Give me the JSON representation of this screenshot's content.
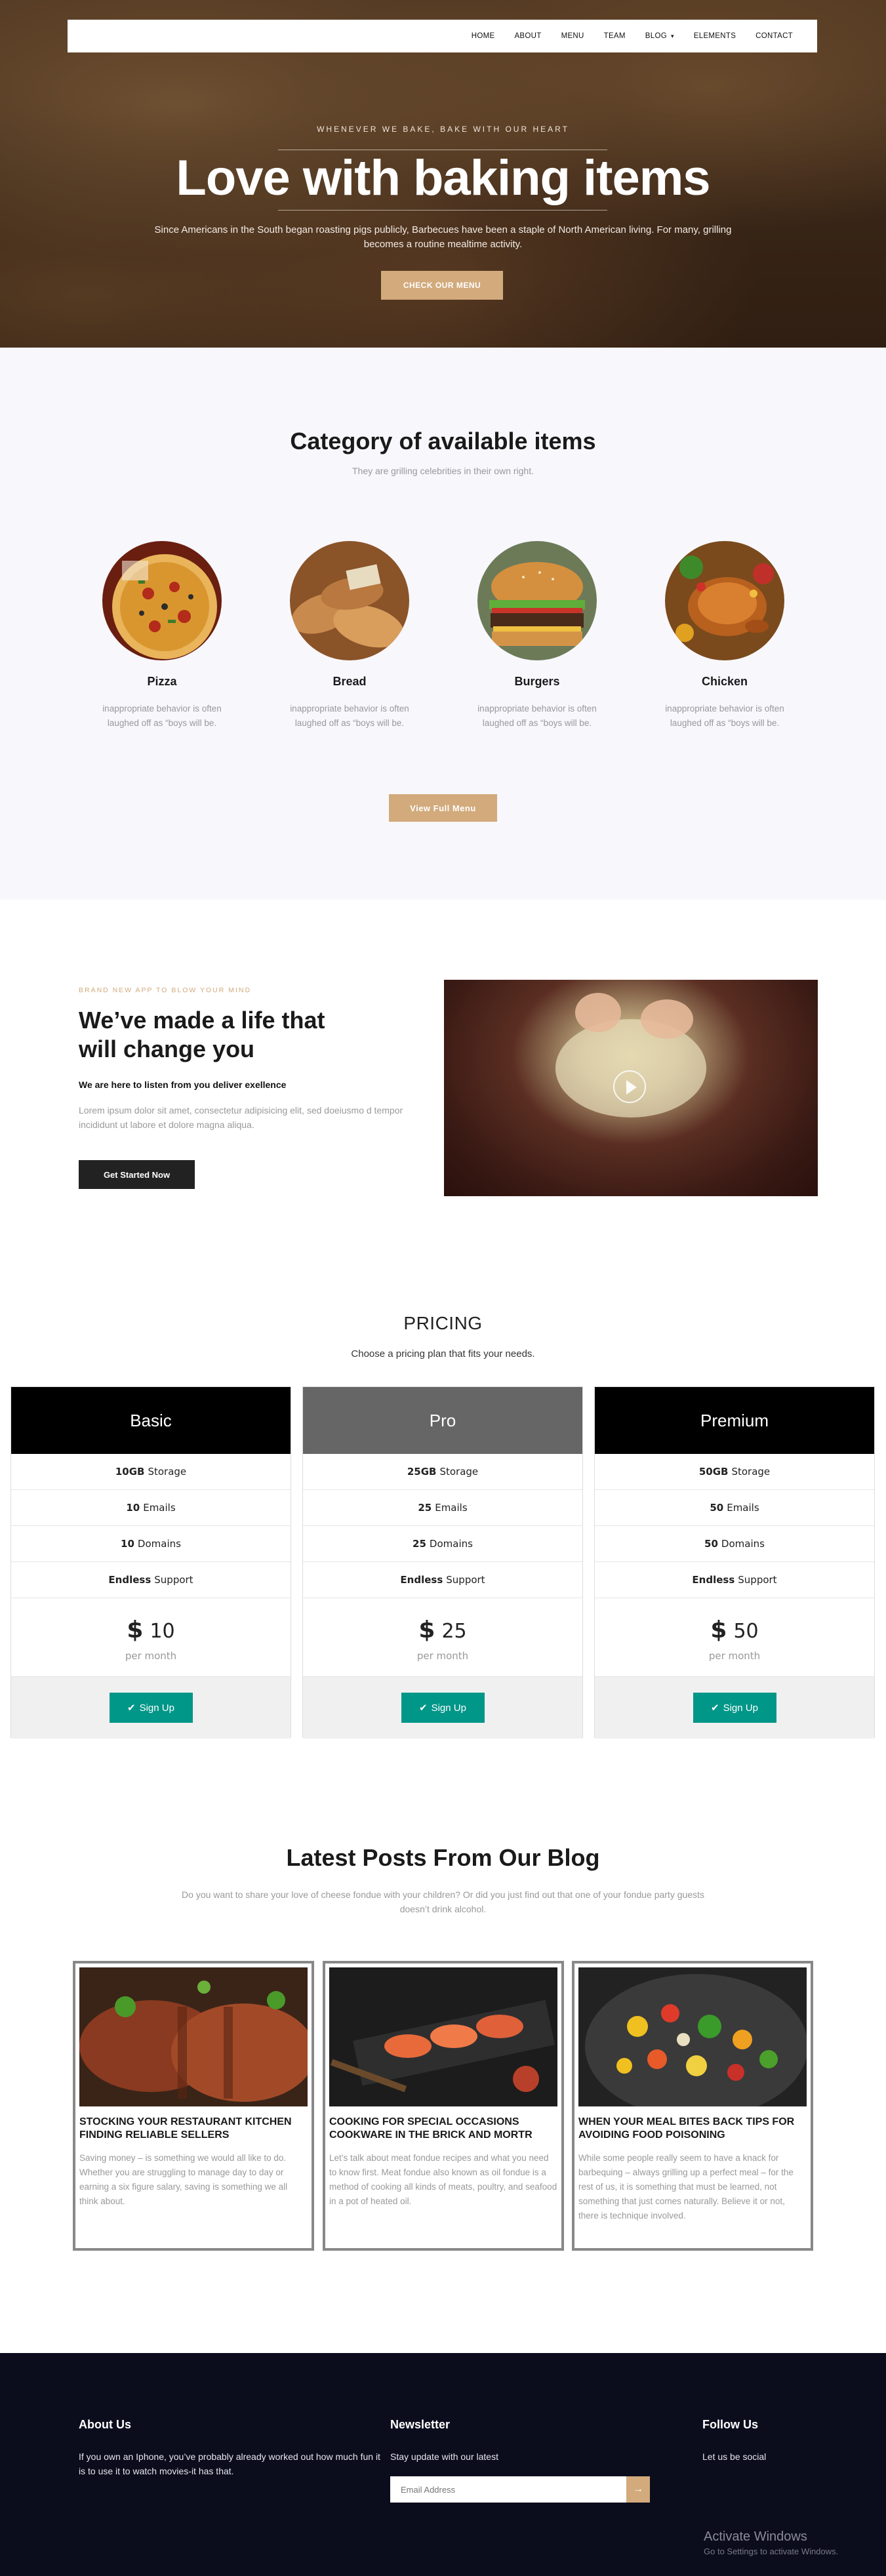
{
  "nav": {
    "items": [
      "HOME",
      "ABOUT",
      "MENU",
      "TEAM",
      "BLOG",
      "ELEMENTS",
      "CONTACT"
    ]
  },
  "hero": {
    "tagline": "WHENEVER WE BAKE, BAKE WITH OUR HEART",
    "title": "Love with baking items",
    "description": "Since Americans in the South began roasting pigs publicly, Barbecues have been a staple of North American living. For many, grilling becomes a routine mealtime activity.",
    "cta": "CHECK OUR MENU"
  },
  "category": {
    "title": "Category of available items",
    "subtitle": "They are grilling celebrities in their own right.",
    "items": [
      {
        "name": "Pizza",
        "text": "inappropriate behavior is often laughed off as “boys will be."
      },
      {
        "name": "Bread",
        "text": "inappropriate behavior is often laughed off as “boys will be."
      },
      {
        "name": "Burgers",
        "text": "inappropriate behavior is often laughed off as “boys will be."
      },
      {
        "name": "Chicken",
        "text": "inappropriate behavior is often laughed off as “boys will be."
      }
    ],
    "button": "View Full Menu"
  },
  "feature": {
    "tag": "BRAND NEW APP TO BLOW YOUR MIND",
    "title": "We’ve made a life that will change you",
    "lead": "We are here to listen from you deliver exellence",
    "body": "Lorem ipsum dolor sit amet, consectetur adipisicing elit, sed doeiusmo d tempor incididunt ut labore et dolore magna aliqua.",
    "button": "Get Started Now"
  },
  "pricing": {
    "title": "PRICING",
    "subtitle": "Choose a pricing plan that fits your needs.",
    "plans": [
      {
        "name": "Basic",
        "color": "#000000",
        "storage": "10GB",
        "emails": "10",
        "domains": "10",
        "support": "Endless",
        "currency": "$",
        "price": "10",
        "period": "per month",
        "button": "Sign Up"
      },
      {
        "name": "Pro",
        "color": "#666666",
        "storage": "25GB",
        "emails": "25",
        "domains": "25",
        "support": "Endless",
        "currency": "$",
        "price": "25",
        "period": "per month",
        "button": "Sign Up"
      },
      {
        "name": "Premium",
        "color": "#000000",
        "storage": "50GB",
        "emails": "50",
        "domains": "50",
        "support": "Endless",
        "currency": "$",
        "price": "50",
        "period": "per month",
        "button": "Sign Up"
      }
    ],
    "labels": {
      "storage": "Storage",
      "emails": "Emails",
      "domains": "Domains",
      "support": "Support"
    }
  },
  "blog": {
    "title": "Latest Posts From Our Blog",
    "subtitle": "Do you want to share your love of cheese fondue with your children? Or did you just find out that one of your fondue party guests doesn’t drink alcohol.",
    "posts": [
      {
        "title": "STOCKING YOUR RESTAURANT KITCHEN FINDING RELIABLE SELLERS",
        "text": "Saving money – is something we would all like to do. Whether you are struggling to manage day to day or earning a six figure salary, saving is something we all think about."
      },
      {
        "title": "COOKING FOR SPECIAL OCCASIONS COOKWARE IN THE BRICK AND MORTR",
        "text": "Let’s talk about meat fondue recipes and what you need to know first. Meat fondue also known as oil fondue is a method of cooking all kinds of meats, poultry, and seafood in a pot of heated oil."
      },
      {
        "title": "WHEN YOUR MEAL BITES BACK TIPS FOR AVOIDING FOOD POISONING",
        "text": "While some people really seem to have a knack for barbequing – always grilling up a perfect meal – for the rest of us, it is something that must be learned, not something that just comes naturally. Believe it or not, there is technique involved."
      }
    ]
  },
  "footer": {
    "about_title": "About Us",
    "about_text": "If you own an Iphone, you’ve probably already worked out how much fun it is to use it to watch movies-it has that.",
    "newsletter_title": "Newsletter",
    "newsletter_text": "Stay update with our latest",
    "email_placeholder": "Email Address",
    "submit_icon": "→",
    "follow_title": "Follow Us",
    "follow_text": "Let us be social",
    "activate_title": "Activate Windows",
    "activate_text": "Go to Settings to activate Windows."
  },
  "icons": {
    "caret": "▾",
    "check": "✔"
  },
  "colors": {
    "accent": "#d2aa7c",
    "signup": "#009688",
    "footer_bg": "#0b0c1c"
  }
}
